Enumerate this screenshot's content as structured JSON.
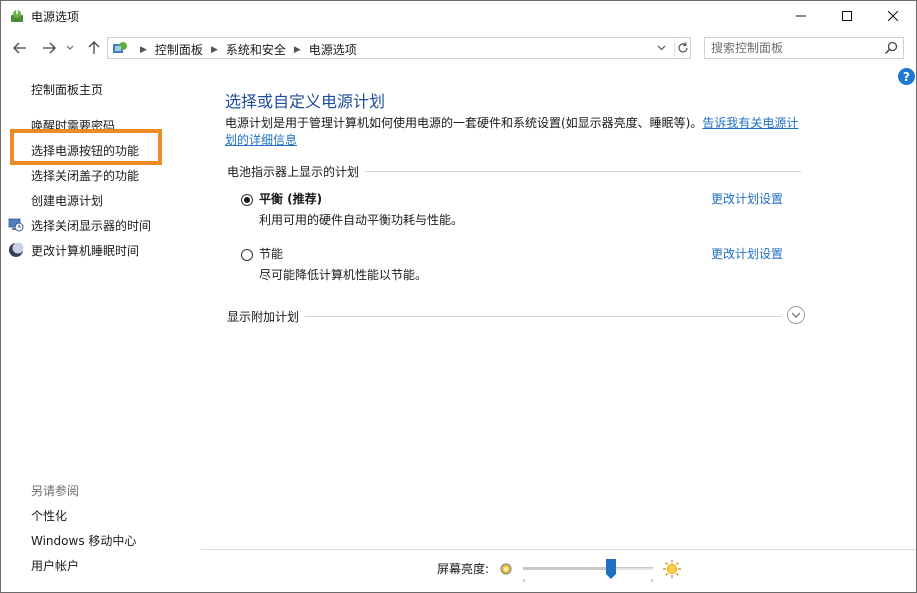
{
  "window": {
    "title": "电源选项"
  },
  "nav": {
    "breadcrumbs": [
      "控制面板",
      "系统和安全",
      "电源选项"
    ],
    "search_placeholder": "搜索控制面板"
  },
  "sidebar": {
    "home": "控制面板主页",
    "links": [
      {
        "label": "唤醒时需要密码",
        "icon": ""
      },
      {
        "label": "选择电源按钮的功能",
        "icon": "",
        "highlighted": true
      },
      {
        "label": "选择关闭盖子的功能",
        "icon": ""
      },
      {
        "label": "创建电源计划",
        "icon": ""
      },
      {
        "label": "选择关闭显示器的时间",
        "icon": "monitor-clock-icon"
      },
      {
        "label": "更改计算机睡眠时间",
        "icon": "moon-icon"
      }
    ],
    "see_also_title": "另请参阅",
    "see_also": [
      "个性化",
      "Windows 移动中心",
      "用户帐户"
    ]
  },
  "main": {
    "title": "选择或自定义电源计划",
    "description": "电源计划是用于管理计算机如何使用电源的一套硬件和系统设置(如显示器亮度、睡眠等)。",
    "description_link": "告诉我有关电源计划的详细信息",
    "group_heading": "电池指示器上显示的计划",
    "plans": [
      {
        "name": "平衡 (推荐)",
        "desc": "利用可用的硬件自动平衡功耗与性能。",
        "selected": true,
        "link": "更改计划设置"
      },
      {
        "name": "节能",
        "desc": "尽可能降低计算机性能以节能。",
        "selected": false,
        "link": "更改计划设置"
      }
    ],
    "more_heading": "显示附加计划"
  },
  "brightness": {
    "label": "屏幕亮度:",
    "level_percent": 68
  },
  "colors": {
    "accent": "#1f6fc5",
    "title": "#1e4d9b",
    "highlight_border": "#f08a24",
    "help": "#1f78d1"
  }
}
